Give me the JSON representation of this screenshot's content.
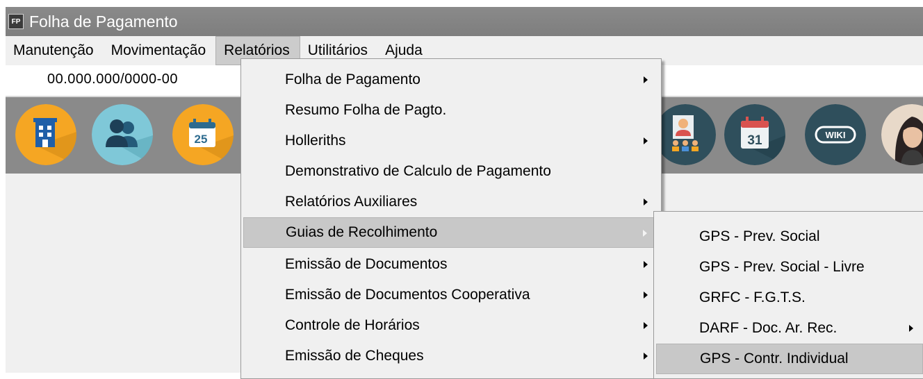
{
  "window": {
    "icon_label": "FP",
    "title": "Folha de Pagamento"
  },
  "menubar": [
    {
      "label": "Manutenção"
    },
    {
      "label": "Movimentação"
    },
    {
      "label": "Relatórios"
    },
    {
      "label": "Utilitários"
    },
    {
      "label": "Ajuda"
    }
  ],
  "cnpj": "00.000.000/0000-00",
  "toolbar": {
    "buttons": [
      {
        "icon": "building-icon",
        "color": "#f5a623"
      },
      {
        "icon": "users-icon",
        "color": "#7fc8d8"
      },
      {
        "icon": "calendar-icon",
        "text": "25",
        "color": "#f5a623"
      },
      {
        "icon": "employees-icon",
        "color": "#2f4f5c"
      },
      {
        "icon": "calendar-icon",
        "text": "31",
        "color": "#2f4f5c"
      },
      {
        "icon": "wiki-icon",
        "text": "WIKI",
        "color": "#2f4f5c"
      },
      {
        "icon": "assistant-avatar-icon",
        "color": "#e8d9c9"
      }
    ]
  },
  "relatorios_menu": {
    "items": [
      {
        "label": "Folha de Pagamento",
        "submenu": true
      },
      {
        "label": "Resumo Folha de Pagto.",
        "submenu": false
      },
      {
        "label": "Holleriths",
        "submenu": true
      },
      {
        "label": "Demonstrativo de Calculo de Pagamento",
        "submenu": false
      },
      {
        "label": "Relatórios Auxiliares",
        "submenu": true
      },
      {
        "label": "Guias de Recolhimento",
        "submenu": true
      },
      {
        "label": "Emissão de Documentos",
        "submenu": true
      },
      {
        "label": "Emissão de Documentos Cooperativa",
        "submenu": true
      },
      {
        "label": "Controle de Horários",
        "submenu": true
      },
      {
        "label": "Emissão de Cheques",
        "submenu": true
      }
    ],
    "highlighted": "Guias de Recolhimento"
  },
  "guias_submenu": {
    "items": [
      {
        "label": "GPS - Prev. Social",
        "submenu": false
      },
      {
        "label": "GPS - Prev. Social - Livre",
        "submenu": false
      },
      {
        "label": "GRFC - F.G.T.S.",
        "submenu": false
      },
      {
        "label": "DARF - Doc. Ar. Rec.",
        "submenu": true
      },
      {
        "label": "GPS - Contr. Individual",
        "submenu": false
      }
    ],
    "highlighted": "GPS - Contr. Individual"
  }
}
